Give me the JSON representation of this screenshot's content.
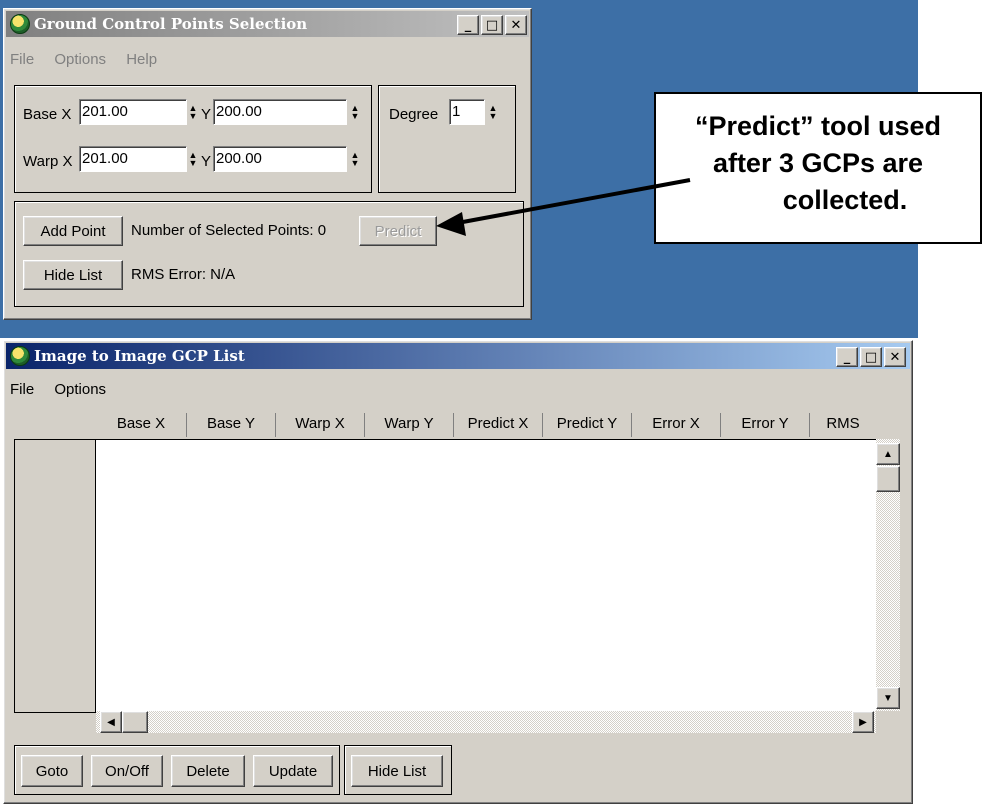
{
  "gcp_selection": {
    "title": "Ground Control Points Selection",
    "menu": [
      "File",
      "Options",
      "Help"
    ],
    "base_x_label": "Base X",
    "base_x_value": "201.00",
    "base_y_label": "Y",
    "base_y_value": "200.00",
    "warp_x_label": "Warp X",
    "warp_x_value": "201.00",
    "warp_y_label": "Y",
    "warp_y_value": "200.00",
    "degree_label": "Degree",
    "degree_value": "1",
    "add_point_label": "Add Point",
    "selected_points_text": "Number of Selected Points: 0",
    "predict_label": "Predict",
    "hide_list_label": "Hide List",
    "rms_text": "RMS Error: N/A"
  },
  "callout": {
    "line1": "“Predict” tool used",
    "line2": "after 3 GCPs are",
    "line3": "collected."
  },
  "gcp_list": {
    "title": "Image to Image GCP List",
    "menu": [
      "File",
      "Options"
    ],
    "columns": [
      "Base X",
      "Base Y",
      "Warp X",
      "Warp Y",
      "Predict X",
      "Predict Y",
      "Error X",
      "Error Y",
      "RMS"
    ],
    "buttons": [
      "Goto",
      "On/Off",
      "Delete",
      "Update"
    ],
    "hide_list_label": "Hide List"
  },
  "colors": {
    "desktop": "#3d6fa6",
    "window_face": "#d4d0c8",
    "active_title": "#0a246a",
    "inactive_title": "#808080"
  }
}
